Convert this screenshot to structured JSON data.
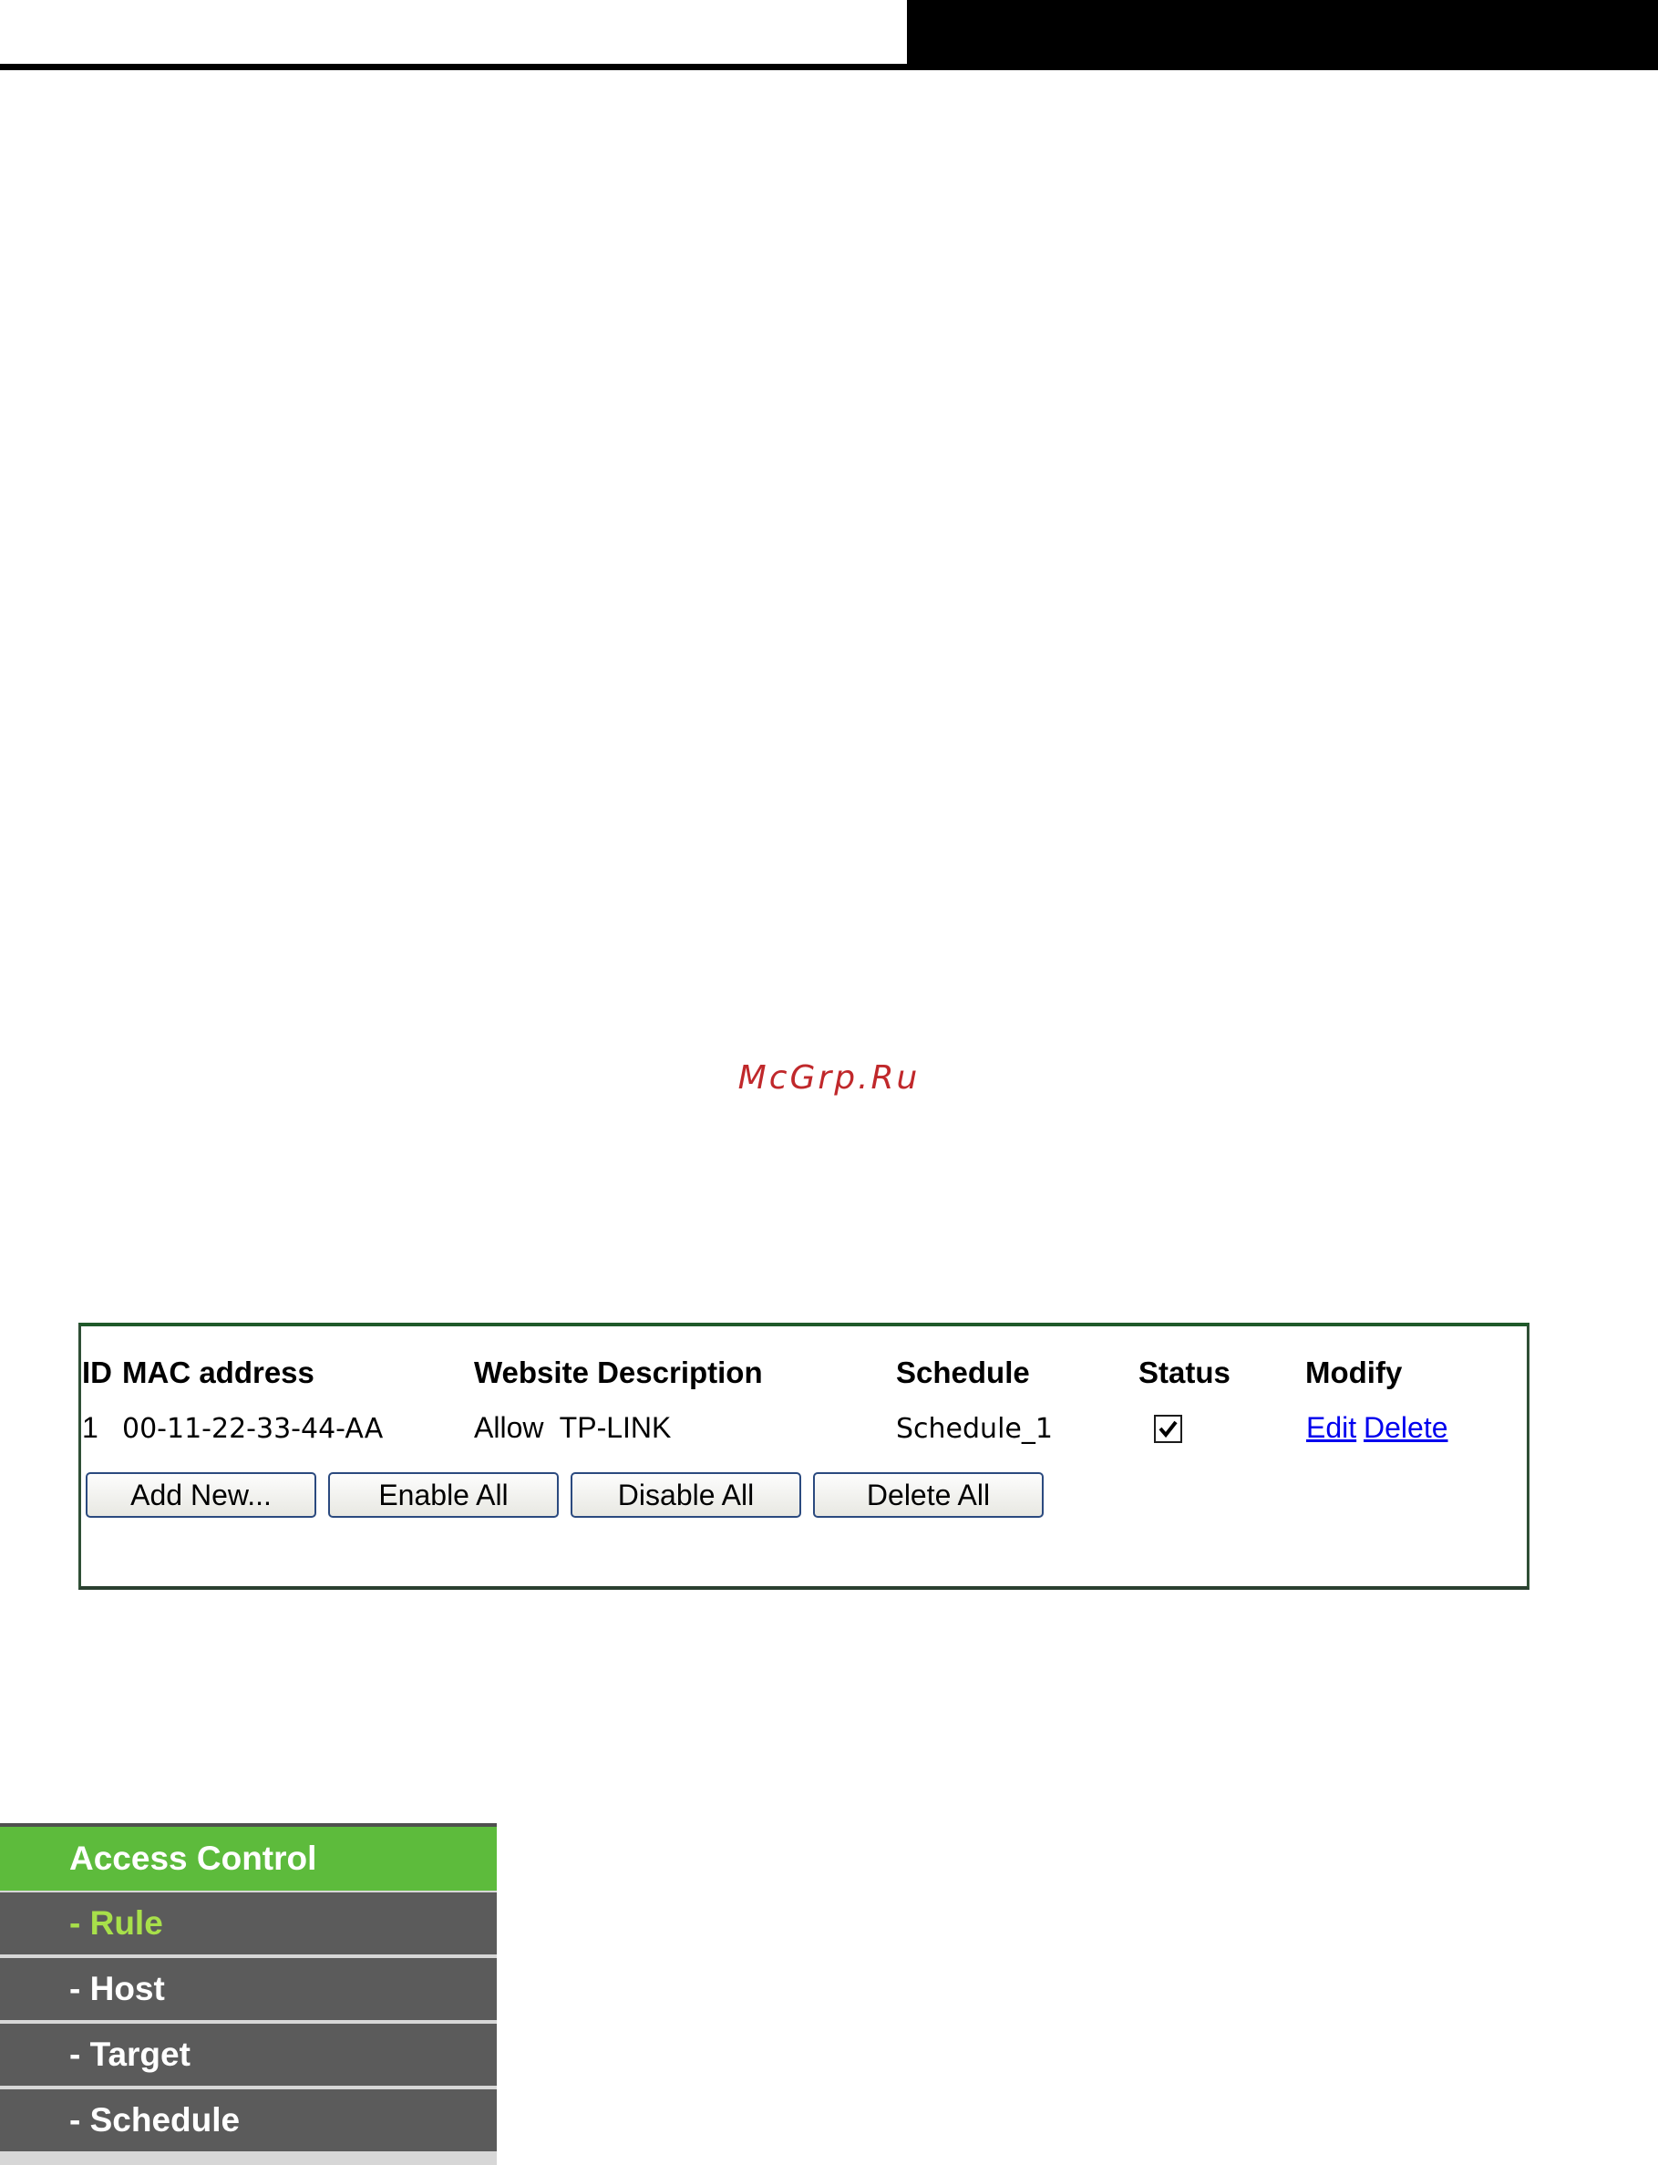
{
  "watermark": "McGrp.Ru",
  "rule_table": {
    "columns": [
      "ID",
      "MAC address",
      "Website Description",
      "Schedule",
      "Status",
      "Modify"
    ],
    "rows": [
      {
        "id": "1",
        "mac": "00-11-22-33-44-AA",
        "description": "Allow  TP-LINK",
        "schedule": "Schedule_1",
        "status_enabled": true,
        "edit_label": "Edit",
        "delete_label": "Delete"
      }
    ],
    "buttons": {
      "add_new": "Add New...",
      "enable_all": "Enable All",
      "disable_all": "Disable All",
      "delete_all": "Delete All"
    }
  },
  "side_menu": {
    "header": "Access Control",
    "items": [
      {
        "label": "- Rule",
        "active": true
      },
      {
        "label": "- Host",
        "active": false
      },
      {
        "label": "- Target",
        "active": false
      },
      {
        "label": "- Schedule",
        "active": false
      }
    ]
  },
  "colors": {
    "menu_header_bg": "#5dbb3c",
    "menu_item_bg": "#5b5b5b",
    "menu_active_text": "#a8e04a",
    "link": "#0000ee",
    "watermark": "#c0282b"
  }
}
